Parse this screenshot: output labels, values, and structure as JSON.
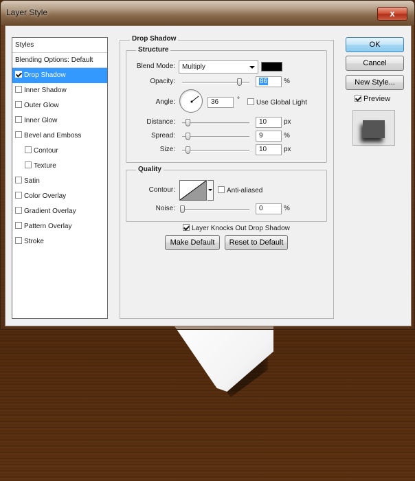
{
  "window": {
    "title": "Layer Style",
    "close_glyph": "x"
  },
  "styles_list": {
    "header": "Styles",
    "blending_options": "Blending Options: Default",
    "items": [
      {
        "label": "Drop Shadow",
        "checked": true,
        "selected": true
      },
      {
        "label": "Inner Shadow",
        "checked": false
      },
      {
        "label": "Outer Glow",
        "checked": false
      },
      {
        "label": "Inner Glow",
        "checked": false
      },
      {
        "label": "Bevel and Emboss",
        "checked": false
      },
      {
        "label": "Contour",
        "checked": false,
        "indent": true
      },
      {
        "label": "Texture",
        "checked": false,
        "indent": true
      },
      {
        "label": "Satin",
        "checked": false
      },
      {
        "label": "Color Overlay",
        "checked": false
      },
      {
        "label": "Gradient Overlay",
        "checked": false
      },
      {
        "label": "Pattern Overlay",
        "checked": false
      },
      {
        "label": "Stroke",
        "checked": false
      }
    ]
  },
  "drop_shadow": {
    "title": "Drop Shadow",
    "structure": {
      "title": "Structure",
      "blend_mode_label": "Blend Mode:",
      "blend_mode_value": "Multiply",
      "shadow_color": "#000000",
      "opacity_label": "Opacity:",
      "opacity_value": "86",
      "opacity_unit": "%",
      "angle_label": "Angle:",
      "angle_value": "36",
      "angle_unit": "°",
      "use_global_light_label": "Use Global Light",
      "use_global_light_checked": false,
      "distance_label": "Distance:",
      "distance_value": "10",
      "distance_unit": "px",
      "spread_label": "Spread:",
      "spread_value": "9",
      "spread_unit": "%",
      "size_label": "Size:",
      "size_value": "10",
      "size_unit": "px"
    },
    "quality": {
      "title": "Quality",
      "contour_label": "Contour:",
      "anti_aliased_label": "Anti-aliased",
      "anti_aliased_checked": false,
      "noise_label": "Noise:",
      "noise_value": "0",
      "noise_unit": "%"
    },
    "knocks_out_label": "Layer Knocks Out Drop Shadow",
    "knocks_out_checked": true,
    "make_default_label": "Make Default",
    "reset_default_label": "Reset to Default"
  },
  "buttons": {
    "ok": "OK",
    "cancel": "Cancel",
    "new_style": "New Style..."
  },
  "preview": {
    "label": "Preview",
    "checked": true
  },
  "colors": {
    "selection_blue": "#3399ff",
    "wood_brown": "#4a2409"
  }
}
